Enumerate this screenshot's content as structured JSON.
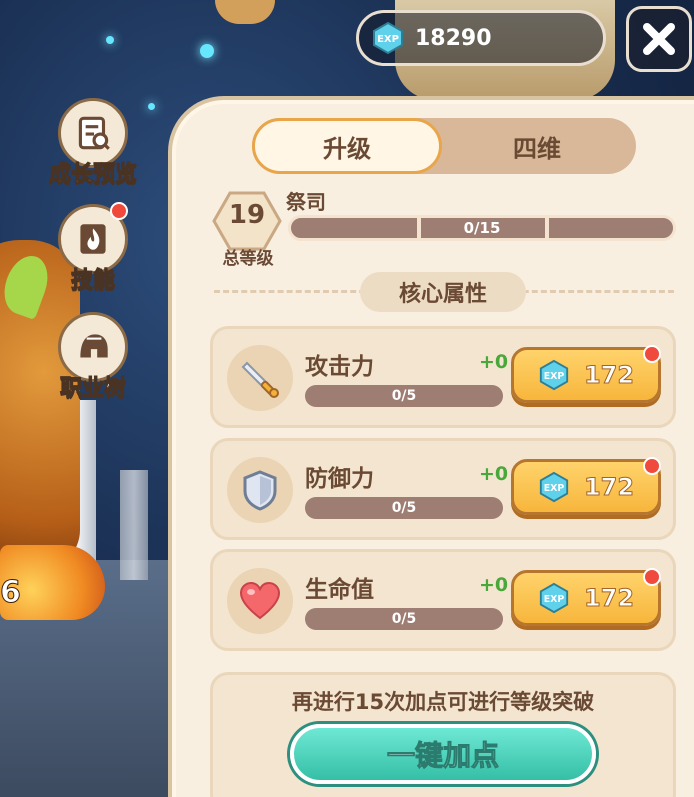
{
  "header": {
    "exp_value": "18290",
    "exp_icon": "exp-gem-icon",
    "close_icon": "close-icon"
  },
  "side_menu": [
    {
      "label": "成长预览",
      "icon": "growth-preview-icon",
      "badge": false
    },
    {
      "label": "技能",
      "icon": "skill-flame-icon",
      "badge": true
    },
    {
      "label": "职业树",
      "icon": "class-tree-helmet-icon",
      "badge": false
    }
  ],
  "background": {
    "level_number": "6"
  },
  "tabs": {
    "active": "升级",
    "inactive": "四维"
  },
  "rank": {
    "level": "19",
    "level_label": "总等级",
    "title": "祭司",
    "progress_text": "0/15",
    "progress": 0
  },
  "section": {
    "title": "核心属性"
  },
  "attributes": [
    {
      "name": "攻击力",
      "plus": "+0",
      "progress_text": "0/5",
      "cost": "172",
      "icon": "sword-icon"
    },
    {
      "name": "防御力",
      "plus": "+0",
      "progress_text": "0/5",
      "cost": "172",
      "icon": "shield-icon"
    },
    {
      "name": "生命值",
      "plus": "+0",
      "progress_text": "0/5",
      "cost": "172",
      "icon": "heart-icon"
    }
  ],
  "footer": {
    "hint": "再进行15次加点可进行等级突破",
    "auto_button": "一键加点"
  },
  "colors": {
    "accent_gold": "#f7b63c",
    "accent_teal": "#35bfa6",
    "text_brown": "#6b4a35",
    "plus_green": "#4aa83a",
    "badge_red": "#f04a3c"
  }
}
